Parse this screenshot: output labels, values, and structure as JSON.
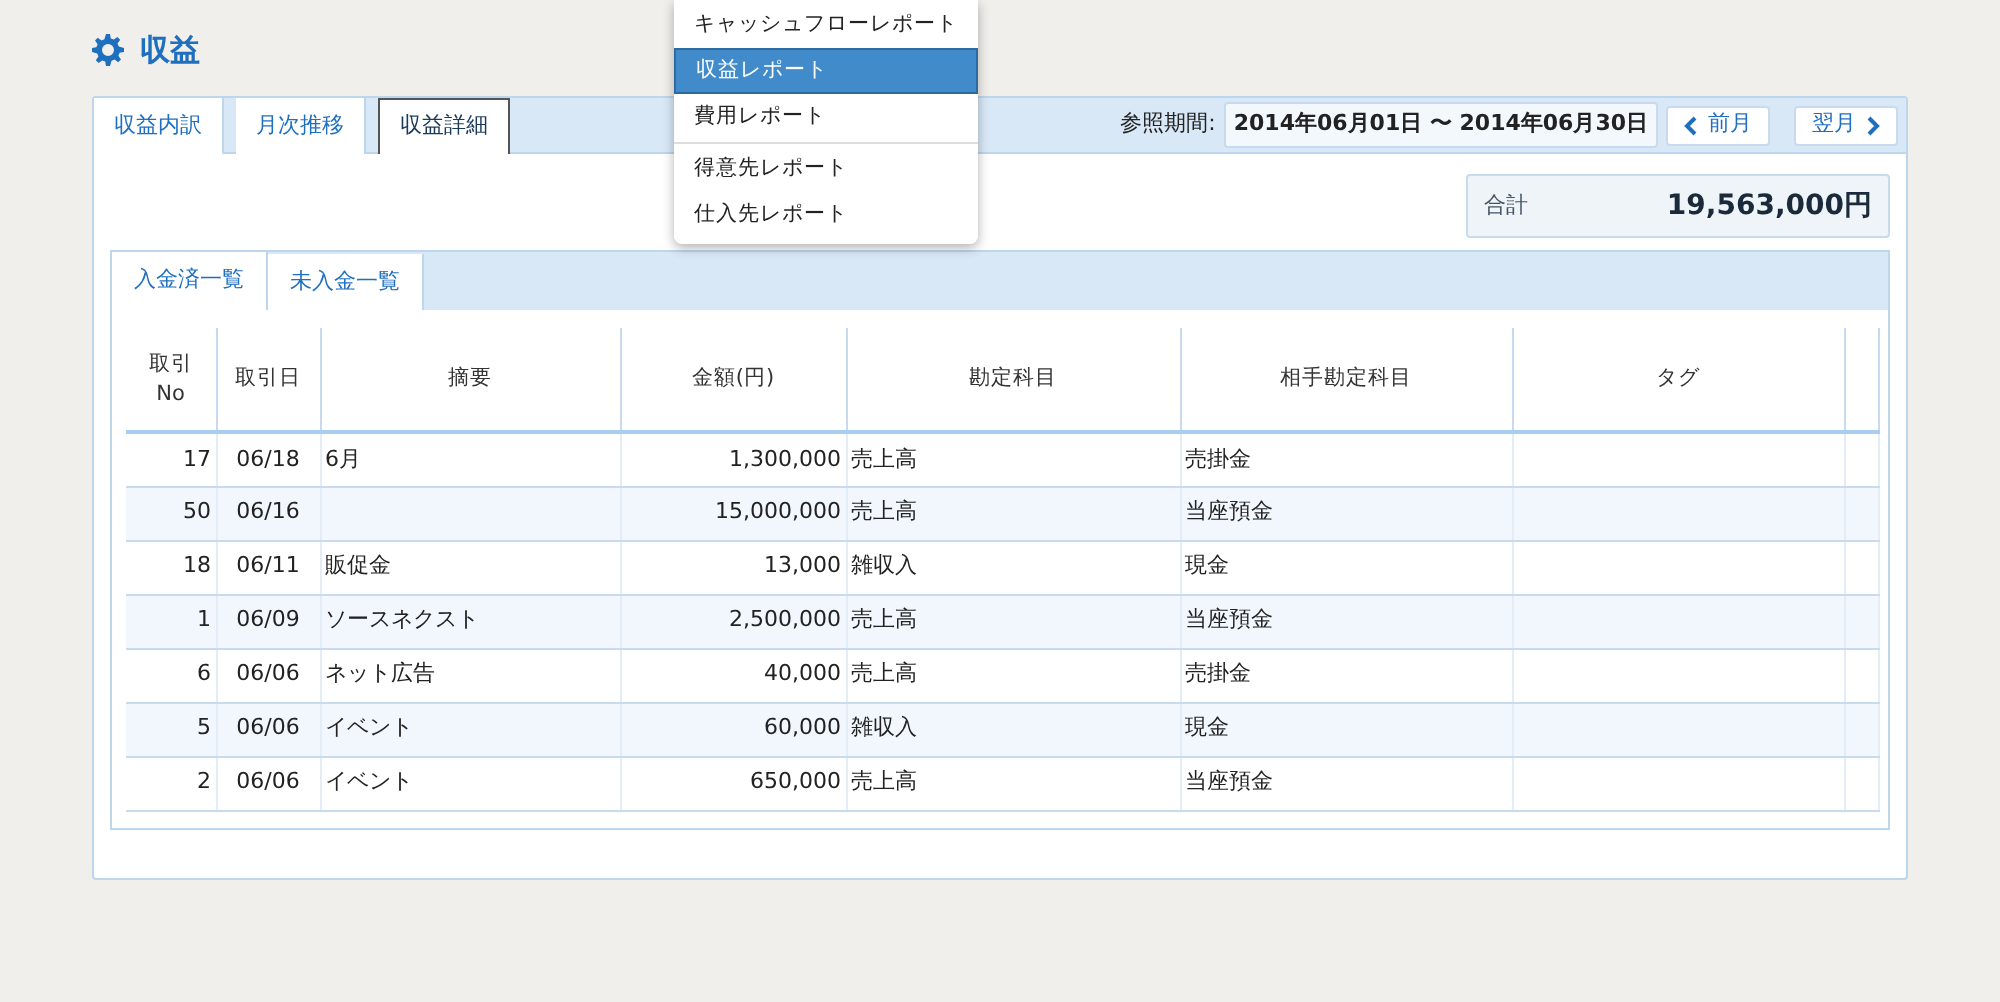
{
  "page_title": "収益",
  "tabs": [
    {
      "label": "収益内訳",
      "selected": false
    },
    {
      "label": "月次推移",
      "selected": false
    },
    {
      "label": "収益詳細",
      "selected": true
    }
  ],
  "period": {
    "label": "参照期間:",
    "value": "2014年06月01日 〜 2014年06月30日",
    "prev": "前月",
    "next": "翌月"
  },
  "total": {
    "label": "合計",
    "value": "19,563,000円"
  },
  "sub_tabs": [
    {
      "label": "入金済一覧",
      "selected": true
    },
    {
      "label": "未入金一覧",
      "selected": false
    }
  ],
  "table": {
    "columns": [
      "取引\nNo",
      "取引日",
      "摘要",
      "金額(円)",
      "勘定科目",
      "相手勘定科目",
      "タグ"
    ],
    "rows": [
      {
        "no": "17",
        "date": "06/18",
        "memo": "6月",
        "amount": "1,300,000",
        "account": "売上高",
        "counter": "売掛金"
      },
      {
        "no": "50",
        "date": "06/16",
        "amount": "15,000,000",
        "account": "売上高",
        "counter": "当座預金"
      },
      {
        "no": "18",
        "date": "06/11",
        "memo": "販促金",
        "amount": "13,000",
        "account": "雑収入",
        "counter": "現金"
      },
      {
        "no": "1",
        "date": "06/09",
        "memo": "ソースネクスト",
        "amount": "2,500,000",
        "account": "売上高",
        "counter": "当座預金"
      },
      {
        "no": "6",
        "date": "06/06",
        "memo": "ネット広告",
        "amount": "40,000",
        "account": "売上高",
        "counter": "売掛金"
      },
      {
        "no": "5",
        "date": "06/06",
        "memo": "イベント",
        "amount": "60,000",
        "account": "雑収入",
        "counter": "現金"
      },
      {
        "no": "2",
        "date": "06/06",
        "memo": "イベント",
        "amount": "650,000",
        "account": "売上高",
        "counter": "当座預金"
      }
    ]
  },
  "menu": {
    "groups": [
      [
        {
          "label": "キャッシュフローレポート",
          "selected": false
        },
        {
          "label": "収益レポート",
          "selected": true
        },
        {
          "label": "費用レポート",
          "selected": false
        }
      ],
      [
        {
          "label": "得意先レポート",
          "selected": false
        },
        {
          "label": "仕入先レポート",
          "selected": false
        }
      ]
    ]
  }
}
